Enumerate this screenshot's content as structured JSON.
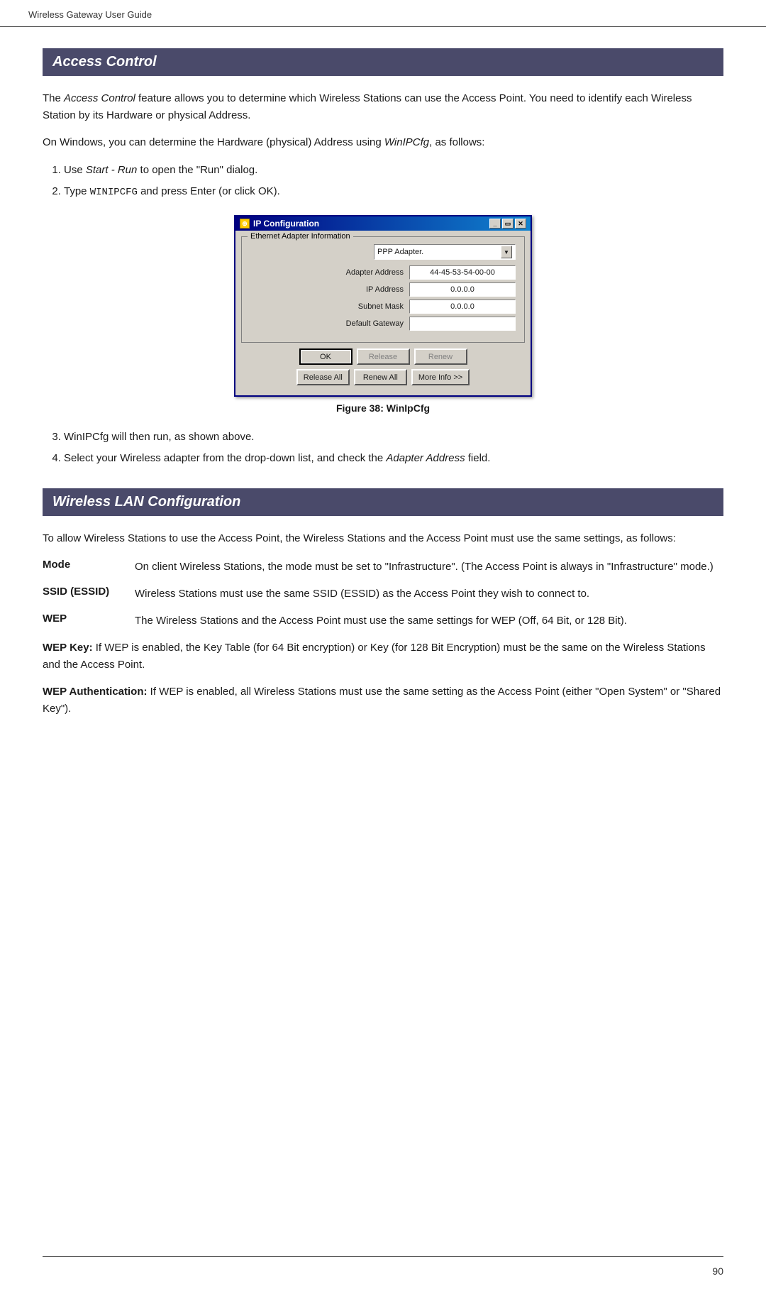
{
  "header": {
    "text": "Wireless Gateway User Guide"
  },
  "access_control": {
    "heading": "Access Control",
    "paragraph1": "The Access Control feature allows you to determine which Wireless Stations can use the Access Point. You need to identify each Wireless Station by its Hardware or physical Address.",
    "paragraph1_italic": "Access Control",
    "paragraph2_prefix": "On Windows, you can determine the Hardware (physical) Address using ",
    "paragraph2_italic": "WinIPCfg",
    "paragraph2_suffix": ", as follows:",
    "steps": [
      {
        "id": 1,
        "text_prefix": "Use ",
        "text_italic": "Start - Run",
        "text_suffix": " to open the \"Run\" dialog."
      },
      {
        "id": 2,
        "text_prefix": "Type ",
        "text_mono": "WINIPCFG",
        "text_suffix": " and press Enter (or click OK)."
      }
    ],
    "dialog": {
      "title": "IP Configuration",
      "group_label": "Ethernet Adapter Information",
      "dropdown_value": "PPP Adapter.",
      "fields": [
        {
          "label": "Adapter Address",
          "value": "44-45-53-54-00-00"
        },
        {
          "label": "IP Address",
          "value": "0.0.0.0"
        },
        {
          "label": "Subnet Mask",
          "value": "0.0.0.0"
        },
        {
          "label": "Default Gateway",
          "value": ""
        }
      ],
      "buttons_row1": [
        "OK",
        "Release",
        "Renew"
      ],
      "buttons_row2": [
        "Release All",
        "Renew All",
        "More Info >>"
      ]
    },
    "figure_caption": "Figure 38: WinIpCfg",
    "step3": "WinIPCfg will then run, as shown above.",
    "step4_prefix": "Select your Wireless adapter from the drop-down list, and check the ",
    "step4_italic": "Adapter Address",
    "step4_suffix": " field."
  },
  "wireless_lan": {
    "heading": "Wireless LAN Configuration",
    "intro": "To allow Wireless Stations to use the Access Point, the Wireless Stations and the Access Point must use the same settings, as follows:",
    "terms": [
      {
        "label": "Mode",
        "desc": "On client Wireless Stations, the mode must be set to \"Infrastructure\". (The Access Point is always in \"Infrastructure\" mode.)"
      },
      {
        "label": "SSID (ESSID)",
        "desc": "Wireless Stations must use the same SSID (ESSID) as the Access Point they wish to connect to."
      },
      {
        "label": "WEP",
        "desc": "The Wireless Stations and the Access Point must use the same settings for WEP (Off, 64 Bit, or 128 Bit)."
      }
    ],
    "wep_key_bold": "WEP Key:",
    "wep_key_text": " If WEP is enabled, the Key Table (for 64 Bit encryption) or Key (for 128 Bit Encryption) must be the same on the Wireless Stations and the Access Point.",
    "wep_auth_bold": "WEP Authentication:",
    "wep_auth_text": " If WEP is enabled, all Wireless Stations must use the same setting as the Access Point (either \"Open System\" or \"Shared Key\")."
  },
  "footer": {
    "page_number": "90"
  }
}
